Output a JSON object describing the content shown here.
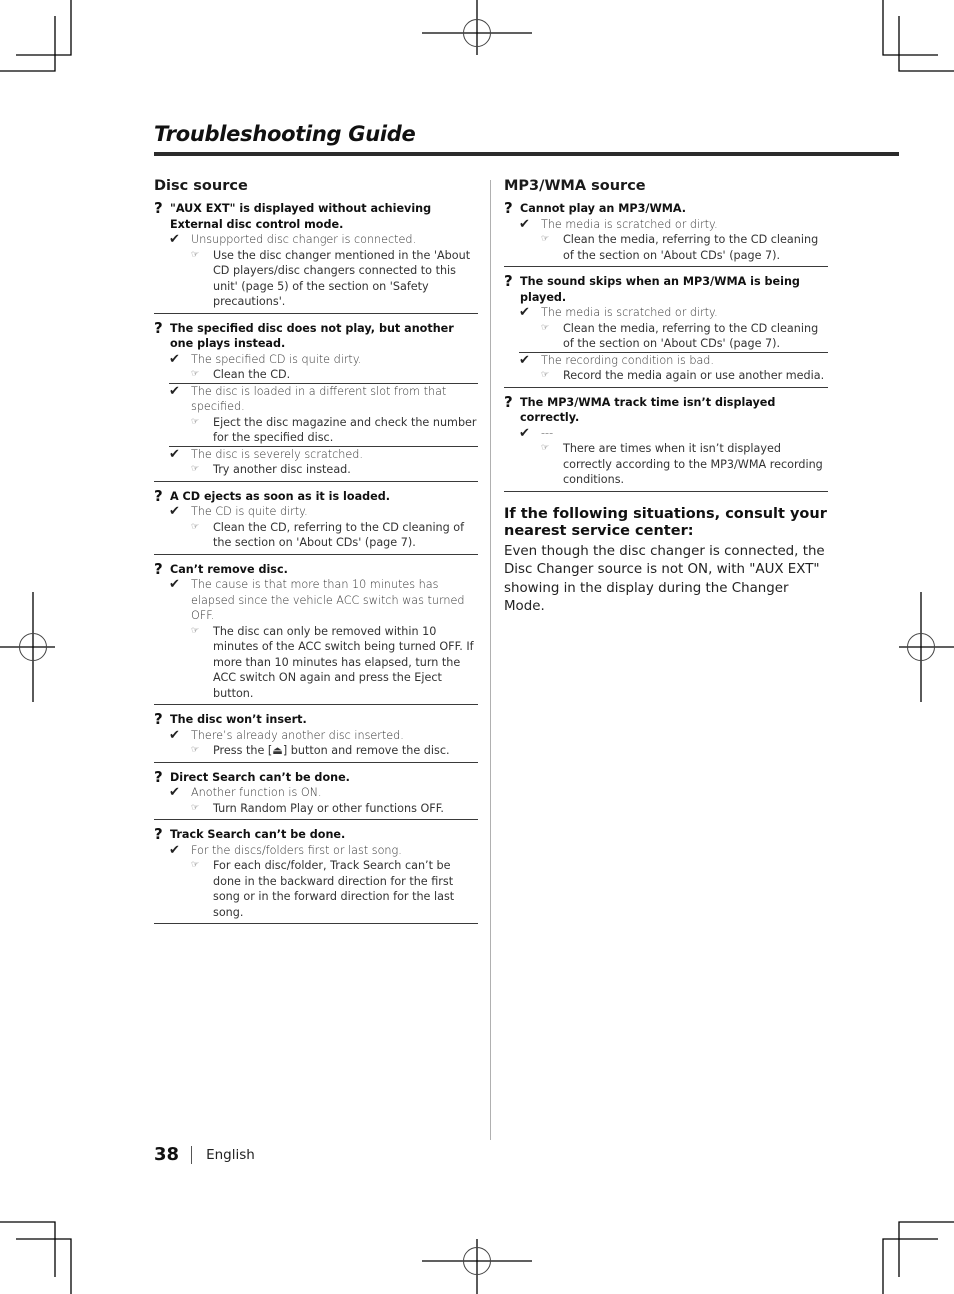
{
  "page": {
    "title": "Troubleshooting Guide",
    "page_number": "38",
    "language": "English"
  },
  "icons": {
    "question": "?",
    "cause": "✔",
    "remedy": "☞"
  },
  "disc_source": {
    "heading": "Disc source",
    "problems": [
      {
        "question": "\"AUX EXT\" is displayed without achieving External disc control mode.",
        "causes": [
          {
            "cause": "Unsupported disc changer is connected.",
            "remedy": "Use the disc changer mentioned in the 'About CD players/disc changers connected to this unit' (page 5) of the section on 'Safety precautions'."
          }
        ]
      },
      {
        "question": "The specified disc does not play, but another one plays instead.",
        "causes": [
          {
            "cause": "The specified CD is quite dirty.",
            "remedy": "Clean the CD."
          },
          {
            "cause": "The disc is loaded in a different slot from that specified.",
            "remedy": "Eject the disc magazine and check the number for the specified disc."
          },
          {
            "cause": "The disc is severely scratched.",
            "remedy": "Try another disc instead."
          }
        ]
      },
      {
        "question": "A CD ejects as soon as it is loaded.",
        "causes": [
          {
            "cause": "The CD is quite dirty.",
            "remedy": "Clean the CD, referring to the CD cleaning of the section on 'About CDs' (page 7)."
          }
        ]
      },
      {
        "question": "Can’t remove disc.",
        "causes": [
          {
            "cause": "The cause is that more than 10 minutes has elapsed since the vehicle ACC switch was turned OFF.",
            "remedy": "The disc can only be removed within 10 minutes of the ACC switch being turned OFF. If more than 10 minutes has elapsed, turn the ACC switch ON again and press the Eject button."
          }
        ]
      },
      {
        "question": "The disc won’t insert.",
        "causes": [
          {
            "cause": "There’s already another disc inserted.",
            "remedy": "Press the [⏏] button and remove the disc."
          }
        ]
      },
      {
        "question": "Direct Search can’t be done.",
        "causes": [
          {
            "cause": "Another function is ON.",
            "remedy": "Turn Random Play or other functions OFF."
          }
        ]
      },
      {
        "question": "Track Search can’t be done.",
        "causes": [
          {
            "cause": "For the discs/folders first or last song.",
            "remedy": "For each disc/folder, Track Search can’t be done in the backward direction for the first song or in the forward direction for the last song."
          }
        ]
      }
    ]
  },
  "mp3_source": {
    "heading": "MP3/WMA source",
    "problems": [
      {
        "question": "Cannot play an MP3/WMA.",
        "causes": [
          {
            "cause": "The media is scratched or dirty.",
            "remedy": "Clean the media, referring to the CD cleaning of the section on 'About CDs' (page 7)."
          }
        ]
      },
      {
        "question": "The sound skips when an MP3/WMA is being played.",
        "causes": [
          {
            "cause": "The media is scratched or dirty.",
            "remedy": "Clean the media, referring to the CD cleaning of the section on 'About CDs' (page 7)."
          },
          {
            "cause": "The recording condition is bad.",
            "remedy": "Record the media again or use another media."
          }
        ]
      },
      {
        "question": "The MP3/WMA track time isn’t displayed correctly.",
        "causes": [
          {
            "cause": "---",
            "remedy": "There are times when it isn’t displayed correctly according to the MP3/WMA recording conditions."
          }
        ]
      }
    ]
  },
  "service_center": {
    "heading": "If the following situations, consult your nearest service center:",
    "body": "Even though the disc changer is connected, the Disc Changer source is not ON, with \"AUX EXT\" showing in the display during the Changer Mode."
  }
}
